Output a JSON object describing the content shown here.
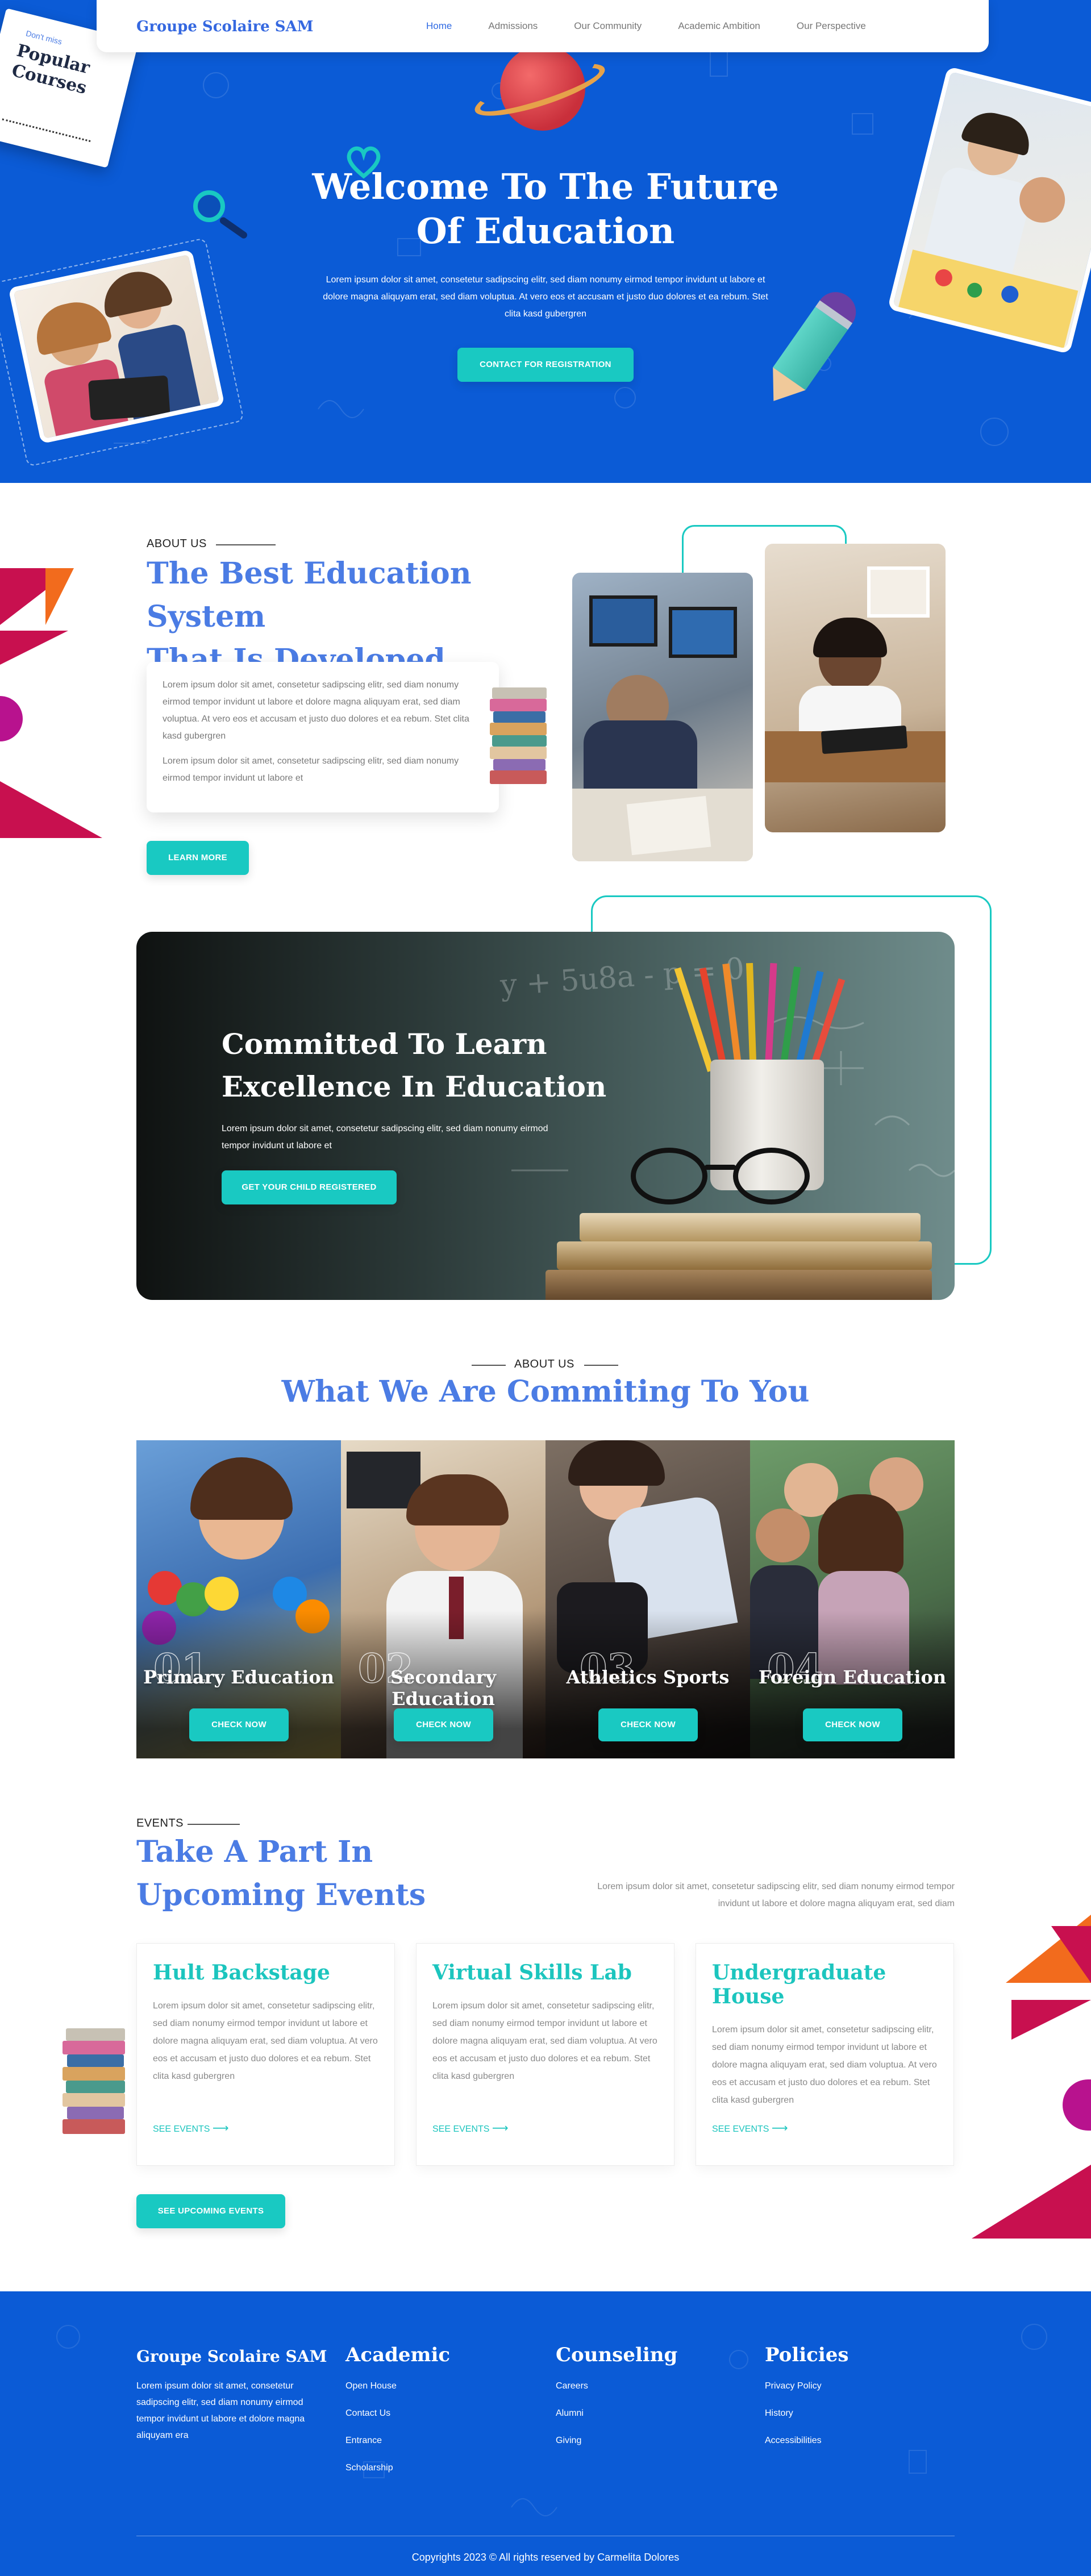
{
  "header": {
    "brand": "Groupe Scolaire SAM",
    "nav": [
      "Home",
      "Admissions",
      "Our Community",
      "Academic Ambition",
      "Our Perspective"
    ],
    "active_nav": "Home"
  },
  "hero": {
    "title_line1": "Welcome To The Future",
    "title_line2": "Of Education",
    "text": "Lorem ipsum dolor sit amet, consetetur sadipscing elitr, sed diam nonumy eirmod tempor invidunt ut labore et dolore magna aliquyam erat, sed diam voluptua. At vero eos et accusam et justo duo dolores et ea rebum. Stet clita kasd gubergren",
    "cta": "CONTACT FOR REGISTRATION",
    "note_small": "Don't miss",
    "note_big_1": "Popular",
    "note_big_2": "Courses"
  },
  "about": {
    "eyebrow": "ABOUT US",
    "title_line1": "The Best Education System",
    "title_line2": "That Is Developed",
    "para1": "Lorem ipsum dolor sit amet, consetetur sadipscing elitr, sed diam nonumy eirmod tempor invidunt ut labore et dolore magna aliquyam erat, sed diam voluptua. At vero eos et accusam et justo duo dolores et ea rebum. Stet clita kasd gubergren",
    "para2": "Lorem ipsum dolor sit amet, consetetur sadipscing elitr, sed diam nonumy eirmod tempor invidunt ut labore et",
    "button": "LEARN MORE"
  },
  "banner": {
    "title_line1": "Committed To Learn",
    "title_line2": "Excellence In Education",
    "text": "Lorem ipsum dolor sit amet, consetetur sadipscing elitr, sed diam nonumy eirmod tempor invidunt ut labore et",
    "button": "GET YOUR CHILD REGISTERED",
    "chalk": "y + 5u8a - p = 0"
  },
  "commitment": {
    "eyebrow": "ABOUT US",
    "title": "What We Are Commiting To You",
    "cards": [
      {
        "num": "01",
        "label": "Primary Education",
        "button": "CHECK NOW"
      },
      {
        "num": "02",
        "label": "Secondary Education",
        "button": "CHECK NOW"
      },
      {
        "num": "03",
        "label": "Athletics Sports",
        "button": "CHECK NOW"
      },
      {
        "num": "04",
        "label": "Foreign Education",
        "button": "CHECK NOW"
      }
    ]
  },
  "events": {
    "eyebrow": "EVENTS",
    "title_line1": "Take A Part In",
    "title_line2": "Upcoming Events",
    "intro": "Lorem ipsum dolor sit amet, consetetur sadipscing elitr, sed diam nonumy eirmod tempor invidunt ut labore et dolore magna aliquyam erat, sed diam",
    "cards": [
      {
        "title": "Hult Backstage",
        "desc": "Lorem ipsum dolor sit amet, consetetur sadipscing elitr, sed diam nonumy eirmod tempor invidunt ut labore et dolore magna aliquyam erat, sed diam voluptua. At vero eos et accusam et justo duo dolores et ea rebum. Stet clita kasd gubergren",
        "link": "SEE EVENTS"
      },
      {
        "title": "Virtual Skills Lab",
        "desc": "Lorem ipsum dolor sit amet, consetetur sadipscing elitr, sed diam nonumy eirmod tempor invidunt ut labore et dolore magna aliquyam erat, sed diam voluptua. At vero eos et accusam et justo duo dolores et ea rebum. Stet clita kasd gubergren",
        "link": "SEE EVENTS"
      },
      {
        "title": "Undergraduate House",
        "desc": "Lorem ipsum dolor sit amet, consetetur sadipscing elitr, sed diam nonumy eirmod tempor invidunt ut labore et dolore magna aliquyam erat, sed diam voluptua. At vero eos et accusam et justo duo dolores et ea rebum. Stet clita kasd gubergren",
        "link": "SEE EVENTS"
      }
    ],
    "button": "SEE UPCOMING EVENTS"
  },
  "footer": {
    "brand": "Groupe Scolaire SAM",
    "about": "Lorem ipsum dolor sit amet, consetetur sadipscing elitr, sed diam nonumy eirmod tempor invidunt ut labore et dolore magna aliquyam era",
    "columns": [
      {
        "title": "Academic",
        "links": [
          "Open House",
          "Contact Us",
          "Entrance",
          "Scholarship"
        ]
      },
      {
        "title": "Counseling",
        "links": [
          "Careers",
          "Alumni",
          "Giving"
        ]
      },
      {
        "title": "Policies",
        "links": [
          "Privacy Policy",
          "History",
          "Accessibilities"
        ]
      }
    ],
    "copyright": "Copyrights 2023 © All rights reserved by Carmelita Dolores"
  },
  "colors": {
    "primary_blue": "#0b5bd6",
    "heading_blue": "#4b7ce4",
    "teal": "#19c9c2",
    "magenta": "#c8104f",
    "orange": "#f26b1d"
  }
}
